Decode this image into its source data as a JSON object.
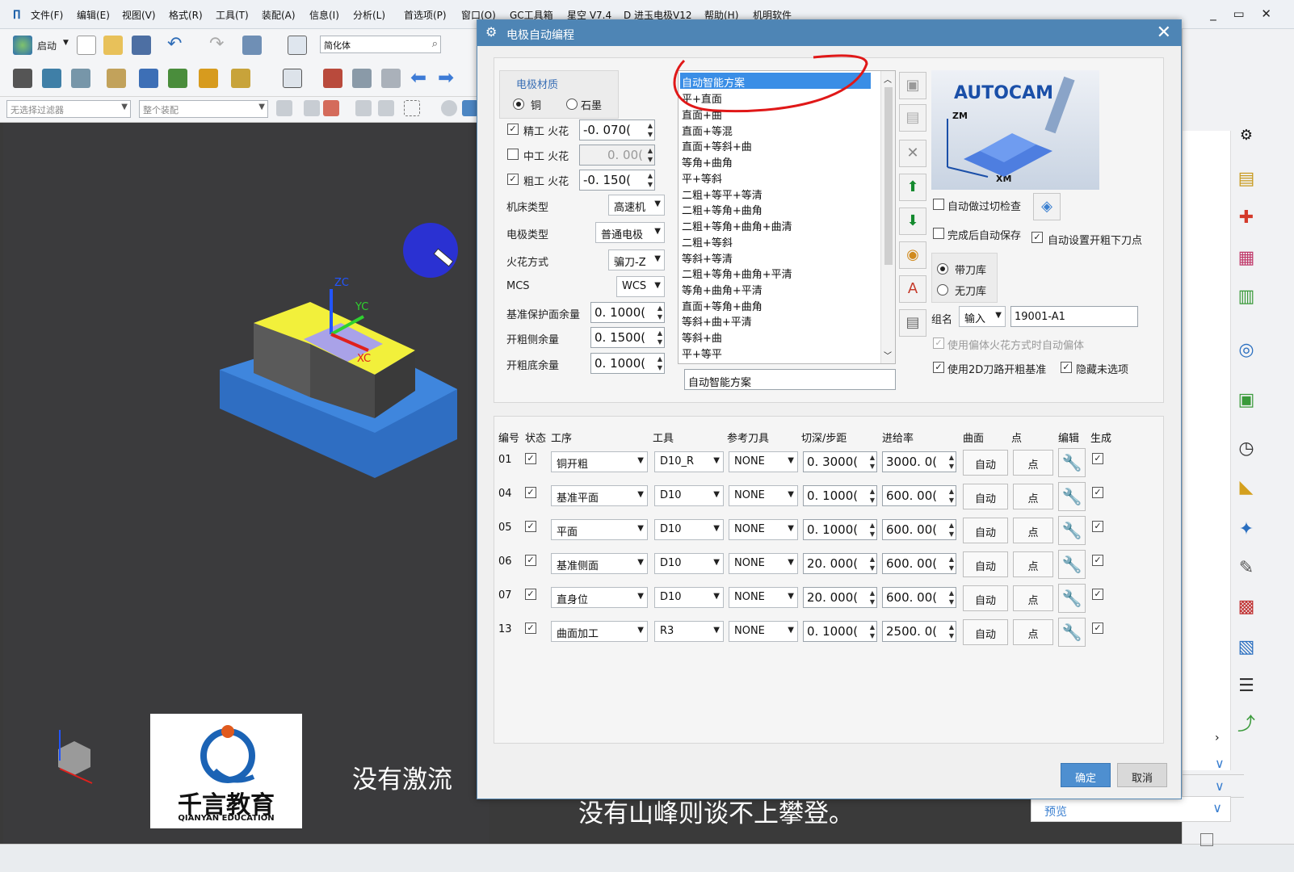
{
  "menubar": {
    "items": [
      "文件(F)",
      "编辑(E)",
      "视图(V)",
      "格式(R)",
      "工具(T)",
      "装配(A)",
      "信息(I)",
      "分析(L)",
      "首选项(P)",
      "窗口(O)",
      "GC工具箱",
      "星空 V7.4",
      "D 进玉电极V12",
      "帮助(H)",
      "机明软件"
    ]
  },
  "toolbar": {
    "start_label": "启动",
    "search_value": "简化体",
    "filter1": "无选择过滤器",
    "filter2": "整个装配"
  },
  "viewport": {
    "axis_zc": "ZC",
    "axis_yc": "YC",
    "axis_xc": "XC",
    "logo_cn": "千言教育",
    "logo_en": "QIANYAN EDUCATION",
    "subtitle_top": "没有激流",
    "subtitle_bottom": "没有山峰则谈不上攀登。"
  },
  "right_panel": {
    "preview_label": "预览"
  },
  "dialog": {
    "title": "电极自动编程",
    "material": {
      "group_label": "电极材质",
      "copper": "铜",
      "graphite": "石墨",
      "selected": "铜"
    },
    "finish_spark": {
      "label": "精工 火花",
      "value": "-0. 070(",
      "checked": true
    },
    "semi_spark": {
      "label": "中工 火花",
      "value": "0. 00(",
      "checked": false
    },
    "rough_spark": {
      "label": "粗工 火花",
      "value": "-0. 150(",
      "checked": true
    },
    "machine_type": {
      "label": "机床类型",
      "value": "高速机"
    },
    "electrode_type": {
      "label": "电极类型",
      "value": "普通电极"
    },
    "spark_mode": {
      "label": "火花方式",
      "value": "骗刀-Z"
    },
    "mcs": {
      "label": "MCS",
      "value": "WCS"
    },
    "base_margin": {
      "label": "基准保护面余量",
      "value": "0. 1000("
    },
    "side_margin": {
      "label": "开粗侧余量",
      "value": "0. 1500("
    },
    "bottom_margin": {
      "label": "开粗底余量",
      "value": "0. 1000("
    },
    "scheme_list": [
      "自动智能方案",
      "平+直面",
      "直面+曲",
      "直面+等混",
      "直面+等斜+曲",
      "等角+曲角",
      "平+等斜",
      "二粗+等平+等清",
      "二粗+等角+曲角",
      "二粗+等角+曲角+曲清",
      "二粗+等斜",
      "等斜+等清",
      "二粗+等角+曲角+平清",
      "等角+曲角+平清",
      "直面+等角+曲角",
      "等斜+曲+平清",
      "等斜+曲",
      "平+等平"
    ],
    "scheme_selected": "自动智能方案",
    "scheme_name_value": "自动智能方案",
    "autocam_logo": "AUTOCAM",
    "axis_zm": "ZM",
    "axis_xm": "XM",
    "auto_gouge_check": {
      "label": "自动做过切检查",
      "checked": false
    },
    "auto_save": {
      "label": "完成后自动保存",
      "checked": false
    },
    "auto_rough_point": {
      "label": "自动设置开粗下刀点",
      "checked": true
    },
    "with_toollib": "带刀库",
    "without_toollib": "无刀库",
    "group_name": {
      "label": "组名",
      "mode": "输入",
      "value": "19001-A1"
    },
    "use_offset_spark": {
      "label": "使用偏体火花方式时自动偏体",
      "checked": true
    },
    "use_2d_path": {
      "label": "使用2D刀路开粗基准",
      "checked": true
    },
    "hide_unselected": {
      "label": "隐藏未选项",
      "checked": true
    },
    "table_headers": [
      "编号",
      "状态",
      "工序",
      "工具",
      "参考刀具",
      "切深/步距",
      "进给率",
      "曲面",
      "点",
      "编辑",
      "生成"
    ],
    "rows": [
      {
        "no": "01",
        "op": "铜开粗",
        "tool": "D10_R",
        "ref": "NONE",
        "depth": "0. 3000(",
        "feed": "3000. 0(",
        "surf": "自动",
        "pt": "点"
      },
      {
        "no": "04",
        "op": "基准平面",
        "tool": "D10",
        "ref": "NONE",
        "depth": "0. 1000(",
        "feed": "600. 00(",
        "surf": "自动",
        "pt": "点"
      },
      {
        "no": "05",
        "op": "平面",
        "tool": "D10",
        "ref": "NONE",
        "depth": "0. 1000(",
        "feed": "600. 00(",
        "surf": "自动",
        "pt": "点"
      },
      {
        "no": "06",
        "op": "基准侧面",
        "tool": "D10",
        "ref": "NONE",
        "depth": "20. 000(",
        "feed": "600. 00(",
        "surf": "自动",
        "pt": "点"
      },
      {
        "no": "07",
        "op": "直身位",
        "tool": "D10",
        "ref": "NONE",
        "depth": "20. 000(",
        "feed": "600. 00(",
        "surf": "自动",
        "pt": "点"
      },
      {
        "no": "13",
        "op": "曲面加工",
        "tool": "R3",
        "ref": "NONE",
        "depth": "0. 1000(",
        "feed": "2500. 0(",
        "surf": "自动",
        "pt": "点"
      }
    ],
    "ok_label": "确定",
    "cancel_label": "取消"
  }
}
